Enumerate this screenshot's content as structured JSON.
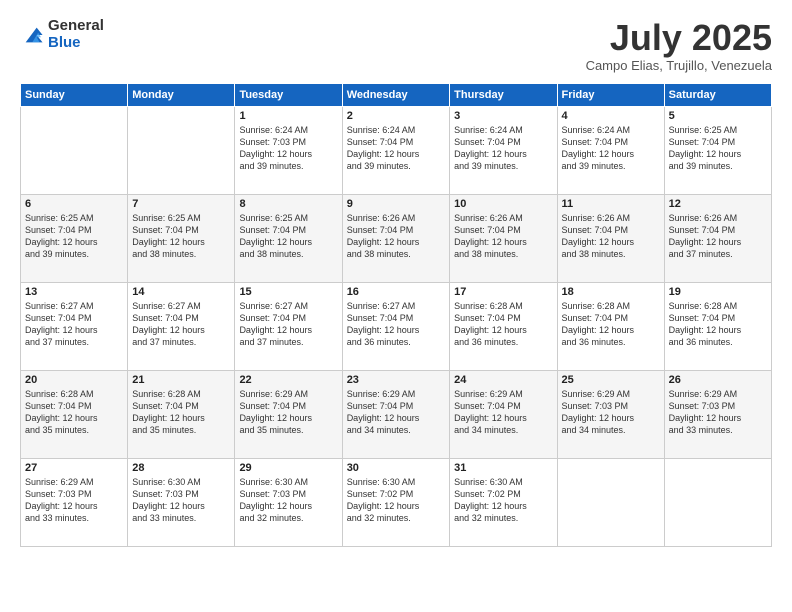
{
  "logo": {
    "general": "General",
    "blue": "Blue"
  },
  "header": {
    "month": "July 2025",
    "location": "Campo Elias, Trujillo, Venezuela"
  },
  "weekdays": [
    "Sunday",
    "Monday",
    "Tuesday",
    "Wednesday",
    "Thursday",
    "Friday",
    "Saturday"
  ],
  "weeks": [
    [
      {
        "day": "",
        "info": ""
      },
      {
        "day": "",
        "info": ""
      },
      {
        "day": "1",
        "info": "Sunrise: 6:24 AM\nSunset: 7:03 PM\nDaylight: 12 hours\nand 39 minutes."
      },
      {
        "day": "2",
        "info": "Sunrise: 6:24 AM\nSunset: 7:04 PM\nDaylight: 12 hours\nand 39 minutes."
      },
      {
        "day": "3",
        "info": "Sunrise: 6:24 AM\nSunset: 7:04 PM\nDaylight: 12 hours\nand 39 minutes."
      },
      {
        "day": "4",
        "info": "Sunrise: 6:24 AM\nSunset: 7:04 PM\nDaylight: 12 hours\nand 39 minutes."
      },
      {
        "day": "5",
        "info": "Sunrise: 6:25 AM\nSunset: 7:04 PM\nDaylight: 12 hours\nand 39 minutes."
      }
    ],
    [
      {
        "day": "6",
        "info": "Sunrise: 6:25 AM\nSunset: 7:04 PM\nDaylight: 12 hours\nand 39 minutes."
      },
      {
        "day": "7",
        "info": "Sunrise: 6:25 AM\nSunset: 7:04 PM\nDaylight: 12 hours\nand 38 minutes."
      },
      {
        "day": "8",
        "info": "Sunrise: 6:25 AM\nSunset: 7:04 PM\nDaylight: 12 hours\nand 38 minutes."
      },
      {
        "day": "9",
        "info": "Sunrise: 6:26 AM\nSunset: 7:04 PM\nDaylight: 12 hours\nand 38 minutes."
      },
      {
        "day": "10",
        "info": "Sunrise: 6:26 AM\nSunset: 7:04 PM\nDaylight: 12 hours\nand 38 minutes."
      },
      {
        "day": "11",
        "info": "Sunrise: 6:26 AM\nSunset: 7:04 PM\nDaylight: 12 hours\nand 38 minutes."
      },
      {
        "day": "12",
        "info": "Sunrise: 6:26 AM\nSunset: 7:04 PM\nDaylight: 12 hours\nand 37 minutes."
      }
    ],
    [
      {
        "day": "13",
        "info": "Sunrise: 6:27 AM\nSunset: 7:04 PM\nDaylight: 12 hours\nand 37 minutes."
      },
      {
        "day": "14",
        "info": "Sunrise: 6:27 AM\nSunset: 7:04 PM\nDaylight: 12 hours\nand 37 minutes."
      },
      {
        "day": "15",
        "info": "Sunrise: 6:27 AM\nSunset: 7:04 PM\nDaylight: 12 hours\nand 37 minutes."
      },
      {
        "day": "16",
        "info": "Sunrise: 6:27 AM\nSunset: 7:04 PM\nDaylight: 12 hours\nand 36 minutes."
      },
      {
        "day": "17",
        "info": "Sunrise: 6:28 AM\nSunset: 7:04 PM\nDaylight: 12 hours\nand 36 minutes."
      },
      {
        "day": "18",
        "info": "Sunrise: 6:28 AM\nSunset: 7:04 PM\nDaylight: 12 hours\nand 36 minutes."
      },
      {
        "day": "19",
        "info": "Sunrise: 6:28 AM\nSunset: 7:04 PM\nDaylight: 12 hours\nand 36 minutes."
      }
    ],
    [
      {
        "day": "20",
        "info": "Sunrise: 6:28 AM\nSunset: 7:04 PM\nDaylight: 12 hours\nand 35 minutes."
      },
      {
        "day": "21",
        "info": "Sunrise: 6:28 AM\nSunset: 7:04 PM\nDaylight: 12 hours\nand 35 minutes."
      },
      {
        "day": "22",
        "info": "Sunrise: 6:29 AM\nSunset: 7:04 PM\nDaylight: 12 hours\nand 35 minutes."
      },
      {
        "day": "23",
        "info": "Sunrise: 6:29 AM\nSunset: 7:04 PM\nDaylight: 12 hours\nand 34 minutes."
      },
      {
        "day": "24",
        "info": "Sunrise: 6:29 AM\nSunset: 7:04 PM\nDaylight: 12 hours\nand 34 minutes."
      },
      {
        "day": "25",
        "info": "Sunrise: 6:29 AM\nSunset: 7:03 PM\nDaylight: 12 hours\nand 34 minutes."
      },
      {
        "day": "26",
        "info": "Sunrise: 6:29 AM\nSunset: 7:03 PM\nDaylight: 12 hours\nand 33 minutes."
      }
    ],
    [
      {
        "day": "27",
        "info": "Sunrise: 6:29 AM\nSunset: 7:03 PM\nDaylight: 12 hours\nand 33 minutes."
      },
      {
        "day": "28",
        "info": "Sunrise: 6:30 AM\nSunset: 7:03 PM\nDaylight: 12 hours\nand 33 minutes."
      },
      {
        "day": "29",
        "info": "Sunrise: 6:30 AM\nSunset: 7:03 PM\nDaylight: 12 hours\nand 32 minutes."
      },
      {
        "day": "30",
        "info": "Sunrise: 6:30 AM\nSunset: 7:02 PM\nDaylight: 12 hours\nand 32 minutes."
      },
      {
        "day": "31",
        "info": "Sunrise: 6:30 AM\nSunset: 7:02 PM\nDaylight: 12 hours\nand 32 minutes."
      },
      {
        "day": "",
        "info": ""
      },
      {
        "day": "",
        "info": ""
      }
    ]
  ]
}
